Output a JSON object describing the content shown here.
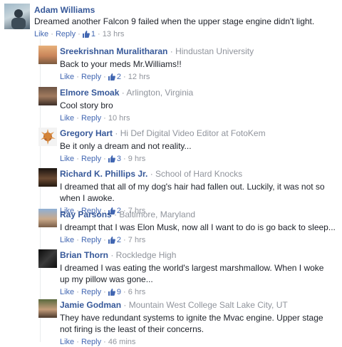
{
  "top": {
    "name": "Adam Williams",
    "text": "Dreamed another Falcon 9 failed when the upper stage engine didn't light.",
    "actions": {
      "like": "Like",
      "reply": "Reply",
      "likes": "1",
      "time": "13 hrs"
    }
  },
  "replies": [
    {
      "name": "Sreekrishnan Muralitharan",
      "affiliation": "Hindustan University",
      "text": "Back to your meds Mr.Williams!!",
      "actions": {
        "like": "Like",
        "reply": "Reply",
        "likes": "2",
        "time": "12 hrs"
      }
    },
    {
      "name": "Elmore Smoak",
      "affiliation": "Arlington, Virginia",
      "text": "Cool story bro",
      "actions": {
        "like": "Like",
        "reply": "Reply",
        "likes": "",
        "time": "10 hrs"
      }
    },
    {
      "name": "Gregory Hart",
      "affiliation": "Hi Def Digital Video Editor at FotoKem",
      "text": "Be it only a dream and not reality...",
      "actions": {
        "like": "Like",
        "reply": "Reply",
        "likes": "3",
        "time": "9 hrs"
      }
    },
    {
      "name": "Richard K. Phillips Jr.",
      "affiliation": "School of Hard Knocks",
      "text": "I dreamed that all of my dog's hair had fallen out. Luckily, it was not so when I awoke.",
      "actions": {
        "like": "Like",
        "reply": "Reply",
        "likes": "2",
        "time": "7 hrs"
      }
    },
    {
      "name": "Ray Parsons",
      "affiliation": "Baltimore, Maryland",
      "text": "I dreampt that I was Elon Musk, now all I want to do is go back to sleep...",
      "actions": {
        "like": "Like",
        "reply": "Reply",
        "likes": "2",
        "time": "7 hrs"
      }
    },
    {
      "name": "Brian Thorn",
      "affiliation": "Rockledge High",
      "text": "I dreamed I was eating the world's largest marshmallow. When I woke up my pillow was gone...",
      "actions": {
        "like": "Like",
        "reply": "Reply",
        "likes": "9",
        "time": "6 hrs"
      }
    },
    {
      "name": "Jamie Godman",
      "affiliation": "Mountain West College Salt Lake City, UT",
      "text": "They have redundant systems to ignite the Mvac engine. Upper stage not firing is the least of their concerns.",
      "actions": {
        "like": "Like",
        "reply": "Reply",
        "likes": "",
        "time": "46 mins"
      }
    }
  ],
  "colors": {
    "name": "#365899",
    "link": "#4267b2",
    "meta": "#90949c",
    "text": "#1d2129"
  }
}
